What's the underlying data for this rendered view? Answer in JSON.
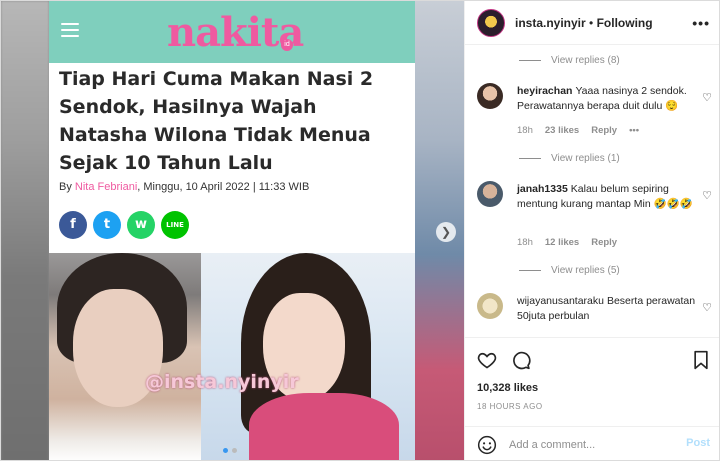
{
  "article": {
    "site_logo": "nakita",
    "site_logo_sub": "id",
    "headline": "Tiap Hari Cuma Makan Nasi 2 Sendok, Hasilnya Wajah Natasha Wilona Tidak Menua Sejak 10 Tahun Lalu",
    "byline_prefix": "By ",
    "byline_author": "Nita Febriani",
    "byline_rest": ", Minggu, 10 April 2022 | 11:33 WIB",
    "share_icons": [
      "f",
      "t",
      "w",
      "LINE"
    ],
    "watermark": "@insta.nyinyir"
  },
  "post": {
    "username": "insta.nyinyir",
    "separator": "•",
    "follow_status": "Following",
    "more_label": "•••"
  },
  "comments": {
    "view_replies": [
      "View replies (8)",
      "View replies (1)",
      "View replies (5)"
    ],
    "items": [
      {
        "user": "heyirachan",
        "text": "Yaaa nasinya 2 sendok. Perawatannya berapa duit dulu 😌",
        "time": "18h",
        "likes": "23 likes",
        "reply": "Reply",
        "more": "•••"
      },
      {
        "user": "janah1335",
        "text": "Kalau belum sepiring mentung kurang mantap Min 🤣🤣🤣",
        "time": "18h",
        "likes": "12 likes",
        "reply": "Reply"
      },
      {
        "user": "wijayanusantaraku",
        "text": "Beserta perawatan 50juta perbulan"
      }
    ]
  },
  "actions": {
    "likes": "10,328 likes",
    "posted": "18 HOURS AGO"
  },
  "add_comment": {
    "placeholder": "Add a comment...",
    "post_label": "Post"
  },
  "colors": {
    "header_teal": "#7fcfbd",
    "brand_pink": "#ef5aa0",
    "post_button_disabled": "#b2dffc"
  }
}
